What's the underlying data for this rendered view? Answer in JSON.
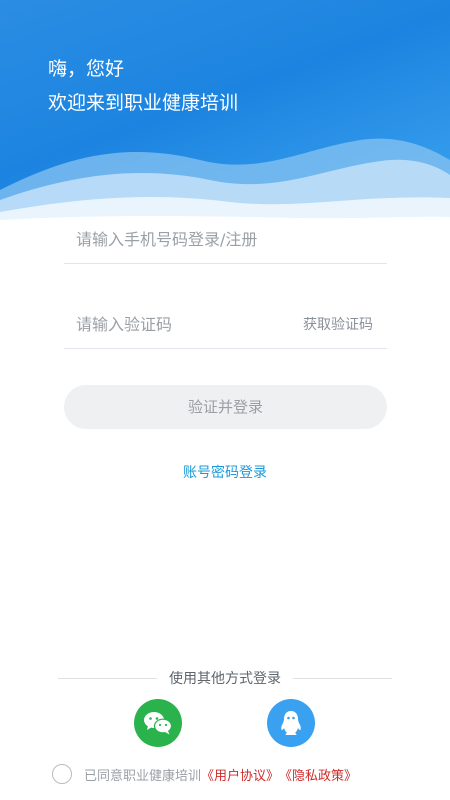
{
  "header": {
    "greeting": "嗨，您好",
    "welcome": "欢迎来到职业健康培训"
  },
  "form": {
    "phone_placeholder": "请输入手机号码登录/注册",
    "code_placeholder": "请输入验证码",
    "get_code_label": "获取验证码",
    "login_button": "验证并登录",
    "password_login_link": "账号密码登录"
  },
  "other_login": {
    "label": "使用其他方式登录",
    "options": [
      {
        "icon": "wechat-icon",
        "color": "#2ab34c"
      },
      {
        "icon": "qq-icon",
        "color": "#3aa0f0"
      }
    ]
  },
  "agreement": {
    "text": "已同意职业健康培训",
    "user_agreement": "《用户协议》",
    "privacy_policy": "《隐私政策》"
  },
  "colors": {
    "brand_blue": "#1c84e0",
    "link": "#1a9ad8",
    "agreement_red": "#d02b2b"
  }
}
